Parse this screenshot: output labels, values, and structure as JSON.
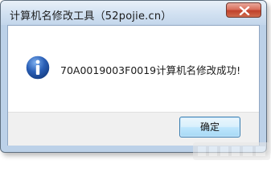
{
  "window": {
    "title": "计算机名修改工具（52pojie.cn）",
    "close_icon": "close-icon"
  },
  "dialog": {
    "icon": "info-icon",
    "message": "70A0019003F0019计算机名修改成功!",
    "ok_label": "确定"
  },
  "colors": {
    "close_button": "#c8472f",
    "info_icon": "#2a5fb6",
    "ok_border": "#3c7fb1"
  }
}
